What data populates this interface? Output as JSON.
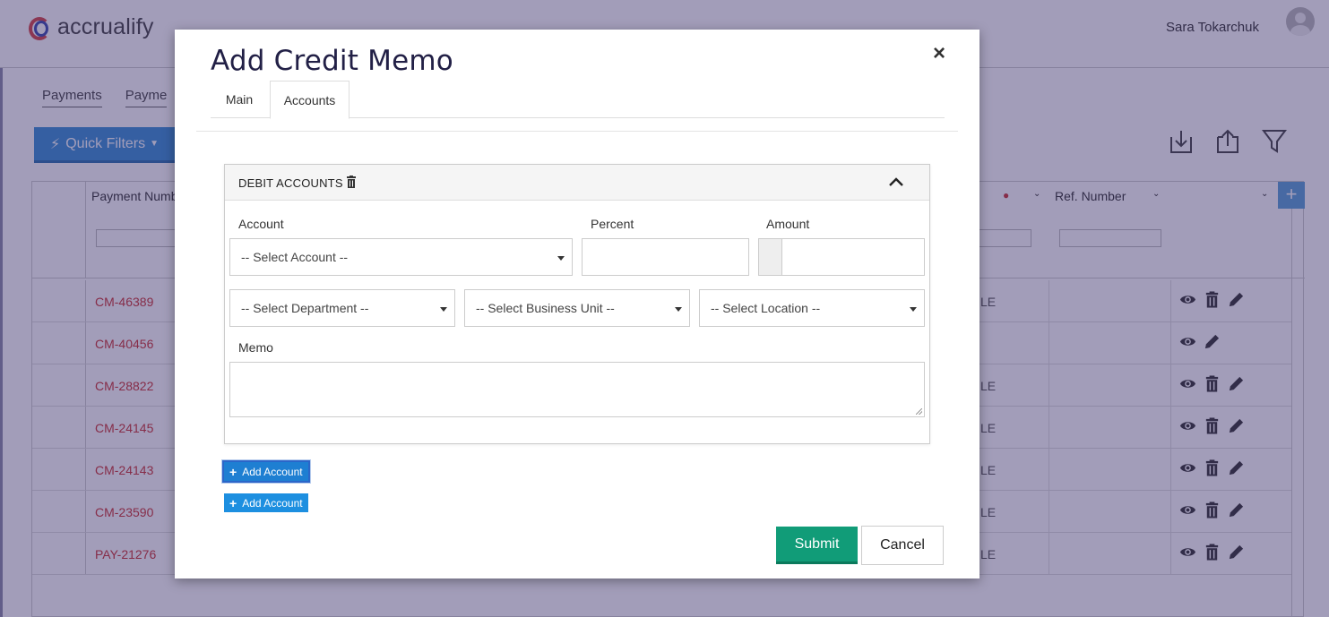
{
  "app": {
    "logo_text": "accrualify",
    "user_name": "Sara Tokarchuk"
  },
  "background": {
    "tabs": [
      "Payments",
      "Payme"
    ],
    "quick_filters_label": "Quick Filters",
    "columns": {
      "payment_number": "Payment Numb",
      "ref_number": "Ref. Number"
    },
    "rows": [
      {
        "number": "CM-46389",
        "status": "LE",
        "actions": [
          "view",
          "delete",
          "edit"
        ]
      },
      {
        "number": "CM-40456",
        "status": "",
        "actions": [
          "view",
          "edit"
        ]
      },
      {
        "number": "CM-28822",
        "status": "LE",
        "actions": [
          "view",
          "delete",
          "edit"
        ]
      },
      {
        "number": "CM-24145",
        "status": "LE",
        "actions": [
          "view",
          "delete",
          "edit"
        ]
      },
      {
        "number": "CM-24143",
        "status": "LE",
        "actions": [
          "view",
          "delete",
          "edit"
        ]
      },
      {
        "number": "CM-23590",
        "status": "LE",
        "actions": [
          "view",
          "delete",
          "edit"
        ]
      },
      {
        "number": "PAY-21276",
        "status": "LE",
        "actions": [
          "view",
          "delete",
          "edit"
        ]
      }
    ]
  },
  "modal": {
    "title": "Add Credit Memo",
    "close_glyph": "×",
    "tabs": [
      {
        "label": "Main",
        "active": false
      },
      {
        "label": "Accounts",
        "active": true
      }
    ],
    "panel": {
      "title": "DEBIT ACCOUNTS",
      "account_label": "Account",
      "account_placeholder": "-- Select Account --",
      "percent_label": "Percent",
      "percent_value": "",
      "amount_label": "Amount",
      "amount_value": "",
      "department_placeholder": "-- Select Department --",
      "business_unit_placeholder": "-- Select Business Unit --",
      "location_placeholder": "-- Select Location --",
      "memo_label": "Memo",
      "memo_value": ""
    },
    "add_account_buttons": [
      "Add Account",
      "Add Account"
    ],
    "submit_label": "Submit",
    "cancel_label": "Cancel"
  },
  "colors": {
    "overlay": "#30266473",
    "primary_blue": "#1d8fe0",
    "submit_green": "#119c78",
    "link_red": "#cc3333",
    "title_navy": "#222046"
  }
}
